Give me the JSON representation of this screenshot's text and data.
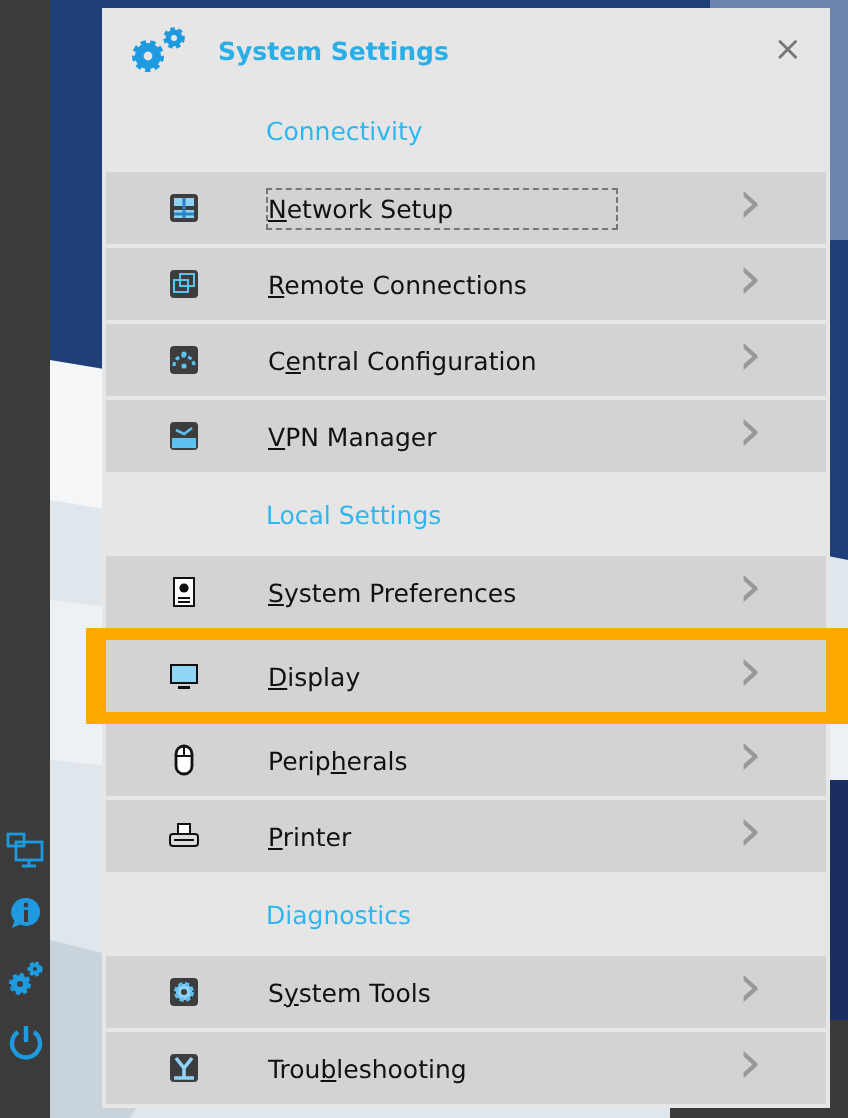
{
  "sidebar": {
    "icons": [
      {
        "kind": "network"
      },
      {
        "kind": "info"
      },
      {
        "kind": "gears"
      },
      {
        "kind": "power"
      }
    ]
  },
  "dialog": {
    "title": "System Settings",
    "close": "×",
    "sections": [
      {
        "heading": "Connectivity",
        "items": [
          {
            "kind": "network",
            "label": {
              "key": "N",
              "after": "etwork Setup"
            },
            "focused": true,
            "selected": false,
            "arrow": "›"
          },
          {
            "kind": "remote",
            "label": {
              "key": "R",
              "after": "emote Connections"
            },
            "focused": false,
            "selected": false,
            "arrow": "›"
          },
          {
            "kind": "central",
            "label": {
              "before": "C",
              "key": "e",
              "after": "ntral Configuration"
            },
            "focused": false,
            "selected": false,
            "arrow": "›"
          },
          {
            "kind": "vpn",
            "label": {
              "key": "V",
              "after": "PN Manager"
            },
            "focused": false,
            "selected": false,
            "arrow": "›"
          }
        ]
      },
      {
        "heading": "Local Settings",
        "items": [
          {
            "kind": "prefs",
            "label": {
              "key": "S",
              "after": "ystem Preferences"
            },
            "focused": false,
            "selected": false,
            "arrow": "›"
          },
          {
            "kind": "display",
            "label": {
              "key": "D",
              "after": "isplay"
            },
            "focused": false,
            "selected": true,
            "arrow": "›"
          },
          {
            "kind": "mouse",
            "label": {
              "before": "Perip",
              "key": "h",
              "after": "erals"
            },
            "focused": false,
            "selected": false,
            "arrow": "›"
          },
          {
            "kind": "printer",
            "label": {
              "key": "P",
              "after": "rinter"
            },
            "focused": false,
            "selected": false,
            "arrow": "›"
          }
        ]
      },
      {
        "heading": "Diagnostics",
        "items": [
          {
            "kind": "tools",
            "label": {
              "before": "S",
              "key": "y",
              "after": "stem Tools"
            },
            "focused": false,
            "selected": false,
            "arrow": "›"
          },
          {
            "kind": "trouble",
            "label": {
              "before": "Trou",
              "key": "b",
              "after": "leshooting"
            },
            "focused": false,
            "selected": false,
            "arrow": "›"
          }
        ]
      }
    ]
  }
}
